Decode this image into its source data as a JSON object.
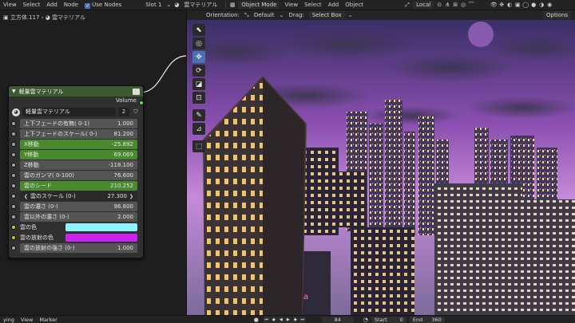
{
  "topbar": {
    "menus": [
      "View",
      "Select",
      "Add",
      "Node"
    ],
    "use_nodes_label": "Use Nodes",
    "slot_label": "Slot 1",
    "material_name": "雲マテリアル",
    "mode_label": "Object Mode",
    "viewport_menus": [
      "View",
      "Select",
      "Add",
      "Object"
    ],
    "transform_label": "Local"
  },
  "breadcrumb": {
    "object": "立方体.117",
    "material": "雲マテリアル"
  },
  "node": {
    "title": "軽量雲マテリアル",
    "output_label": "Volume",
    "group_name": "軽量雲マテリアル",
    "user_count": "2",
    "fields": [
      {
        "label": "上下フェードの有無( 0-1)",
        "value": "1.000",
        "style": "normal"
      },
      {
        "label": "上下フェードのスケール( 0-)",
        "value": "81.200",
        "style": "normal"
      },
      {
        "label": "X移動",
        "value": "-25.892",
        "style": "green"
      },
      {
        "label": "Y移動",
        "value": "69.069",
        "style": "green"
      },
      {
        "label": "Z移動",
        "value": "-118.100",
        "style": "normal"
      },
      {
        "label": "雲のガンマ( 0-100)",
        "value": "76.600",
        "style": "normal"
      },
      {
        "label": "雲のシード",
        "value": "210.252",
        "style": "green"
      },
      {
        "label": "雲のスケール (0-)",
        "value": "27.300",
        "style": "active"
      },
      {
        "label": "雲の濃さ (0-)",
        "value": "96.800",
        "style": "normal"
      },
      {
        "label": "雲以外の濃さ (0-)",
        "value": "2.000",
        "style": "normal"
      }
    ],
    "colors": [
      {
        "label": "雲の色",
        "color": "#8ff3ff"
      },
      {
        "label": "雲の放射の色",
        "color": "#cc22f0"
      }
    ],
    "last_field": {
      "label": "雲の放射の強さ (0-)",
      "value": "1.000"
    }
  },
  "viewport": {
    "orientation_label": "Orientation:",
    "orientation_value": "Default",
    "drag_label": "Drag:",
    "drag_value": "Select Box",
    "options_label": "Options",
    "tools": [
      "cursor-arrow-icon",
      "cursor-3d-icon",
      "move-icon",
      "rotate-icon",
      "scale-icon",
      "transform-icon",
      "annotate-icon",
      "measure-icon",
      "add-cube-icon"
    ]
  },
  "timeline": {
    "playback_label": "ying",
    "view_label": "View",
    "marker_label": "Marker",
    "current_frame": "84",
    "start_label": "Start",
    "start_value": "0",
    "end_label": "End",
    "end_value": "360"
  }
}
